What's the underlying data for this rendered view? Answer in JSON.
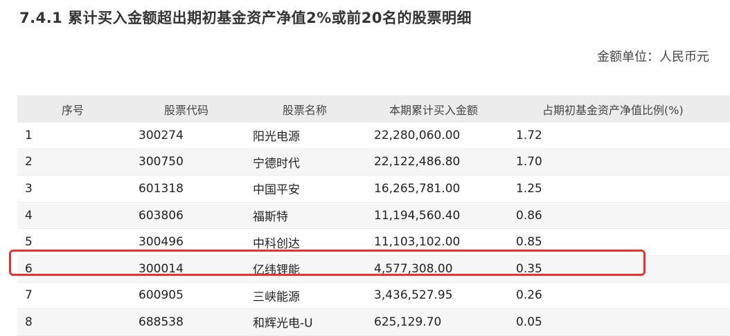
{
  "title": "7.4.1 累计买入金额超出期初基金资产净值2%或前20名的股票明细",
  "unit": "金额单位：人民币元",
  "table": {
    "headers": [
      "序号",
      "股票代码",
      "股票名称",
      "本期累计买入金额",
      "占期初基金资产净值比例(%)"
    ],
    "rows": [
      [
        "1",
        "300274",
        "阳光电源",
        "22,280,060.00",
        "1.72"
      ],
      [
        "2",
        "300750",
        "宁德时代",
        "22,122,486.80",
        "1.70"
      ],
      [
        "3",
        "601318",
        "中国平安",
        "16,265,781.00",
        "1.25"
      ],
      [
        "4",
        "603806",
        "福斯特",
        "11,194,560.40",
        "0.86"
      ],
      [
        "5",
        "300496",
        "中科创达",
        "11,103,102.00",
        "0.85"
      ],
      [
        "6",
        "300014",
        "亿纬锂能",
        "4,577,308.00",
        "0.35"
      ],
      [
        "7",
        "600905",
        "三峡能源",
        "3,436,527.95",
        "0.26"
      ],
      [
        "8",
        "688538",
        "和辉光电-U",
        "625,129.70",
        "0.05"
      ]
    ]
  },
  "highlight_color": "#e83232"
}
